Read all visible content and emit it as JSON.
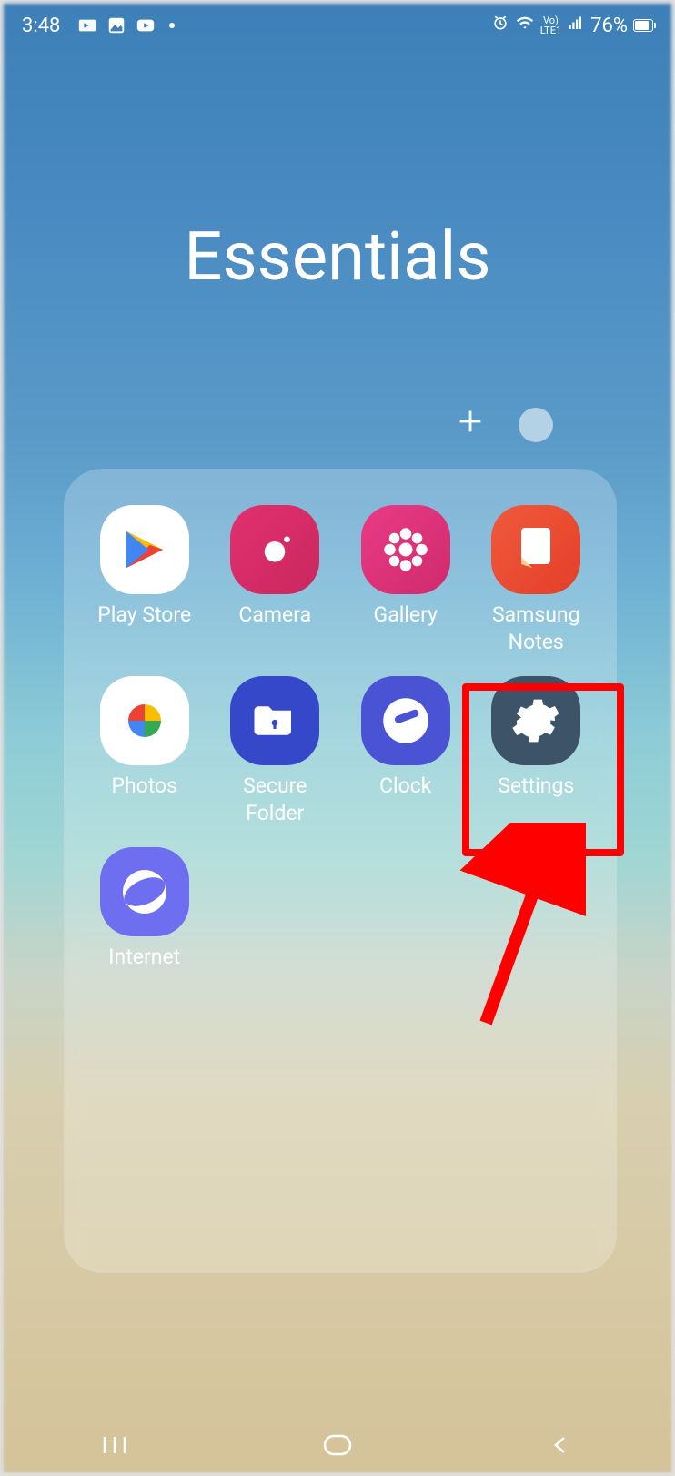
{
  "status": {
    "time": "3:48",
    "battery_pct": "76%",
    "network_label": "Vo)\nLTE1"
  },
  "folder": {
    "title": "Essentials"
  },
  "apps": [
    {
      "label": "Play Store",
      "icon": "play-store",
      "bg": "ic-playstore"
    },
    {
      "label": "Camera",
      "icon": "camera",
      "bg": "ic-camera"
    },
    {
      "label": "Gallery",
      "icon": "gallery",
      "bg": "ic-gallery"
    },
    {
      "label": "Samsung\nNotes",
      "icon": "notes",
      "bg": "ic-notes"
    },
    {
      "label": "Photos",
      "icon": "photos",
      "bg": "ic-photos"
    },
    {
      "label": "Secure\nFolder",
      "icon": "secure-folder",
      "bg": "ic-secure"
    },
    {
      "label": "Clock",
      "icon": "clock",
      "bg": "ic-clock"
    },
    {
      "label": "Settings",
      "icon": "settings",
      "bg": "ic-settings"
    },
    {
      "label": "Internet",
      "icon": "internet",
      "bg": "ic-internet"
    }
  ],
  "annotation": {
    "highlighted_app": "Settings",
    "color": "#ff0000"
  }
}
